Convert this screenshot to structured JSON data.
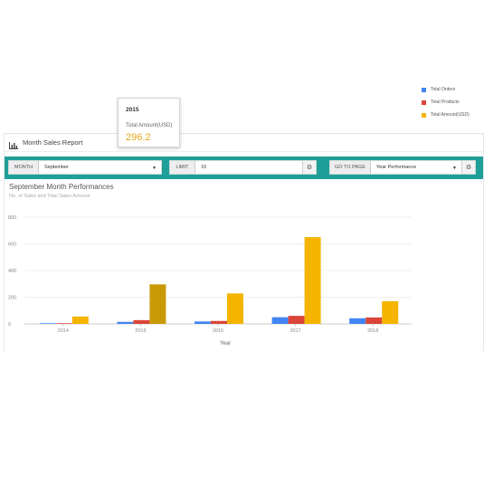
{
  "panel": {
    "title": "Month Sales Report",
    "icon": "bar-chart-icon"
  },
  "filters": {
    "month_label": "MONTH",
    "month_value": "September",
    "limit_label": "LIMIT",
    "limit_value": "10",
    "goto_label": "GO TO PAGE",
    "goto_value": "Year Performance"
  },
  "colors": {
    "toolbar": "#1f9f99",
    "orders": "#4285f4",
    "products": "#db4437",
    "amount": "#f4b400",
    "amount_active": "#c99a05"
  },
  "chart_data": {
    "type": "bar",
    "title": "September Month Performances",
    "subtitle": "No. of Sales and Total Sales Amount",
    "xlabel": "Year",
    "ylabel": "",
    "categories": [
      "2014",
      "2015",
      "2016",
      "2017",
      "2018"
    ],
    "yticks": [
      "0",
      "200",
      "400",
      "600",
      "800"
    ],
    "ylim": [
      0,
      800
    ],
    "grid": true,
    "legend_position": "right",
    "series": [
      {
        "name": "Total Orders",
        "color": "#4285f4",
        "values": [
          5,
          15,
          18,
          50,
          42
        ]
      },
      {
        "name": "Total Products",
        "color": "#db4437",
        "values": [
          5,
          28,
          22,
          60,
          48
        ]
      },
      {
        "name": "Total Amount(USD)",
        "color": "#f4b400",
        "values": [
          55,
          296.2,
          228,
          650,
          170
        ]
      }
    ],
    "tooltip": {
      "category": "2015",
      "label": "Total Amount(USD)",
      "value": "296.2"
    }
  }
}
